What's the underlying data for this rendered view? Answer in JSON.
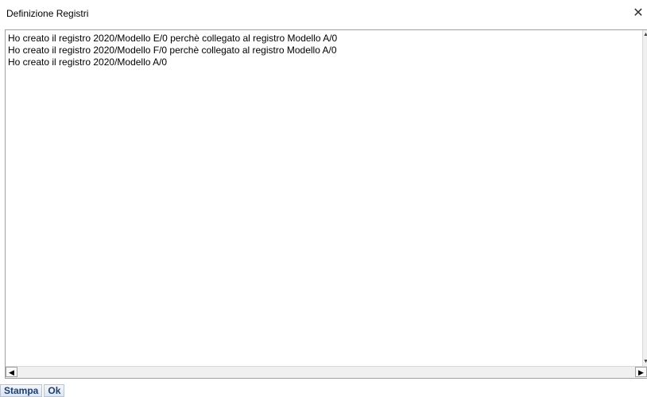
{
  "window": {
    "title": "Definizione Registri",
    "close_icon": "close-icon"
  },
  "log": {
    "lines": [
      "Ho creato il registro 2020/Modello E/0 perchè collegato al registro Modello A/0",
      "Ho creato il registro 2020/Modello F/0 perchè collegato al registro Modello A/0",
      "Ho creato il registro 2020/Modello A/0"
    ]
  },
  "buttons": {
    "print": "Stampa",
    "ok": "Ok"
  }
}
